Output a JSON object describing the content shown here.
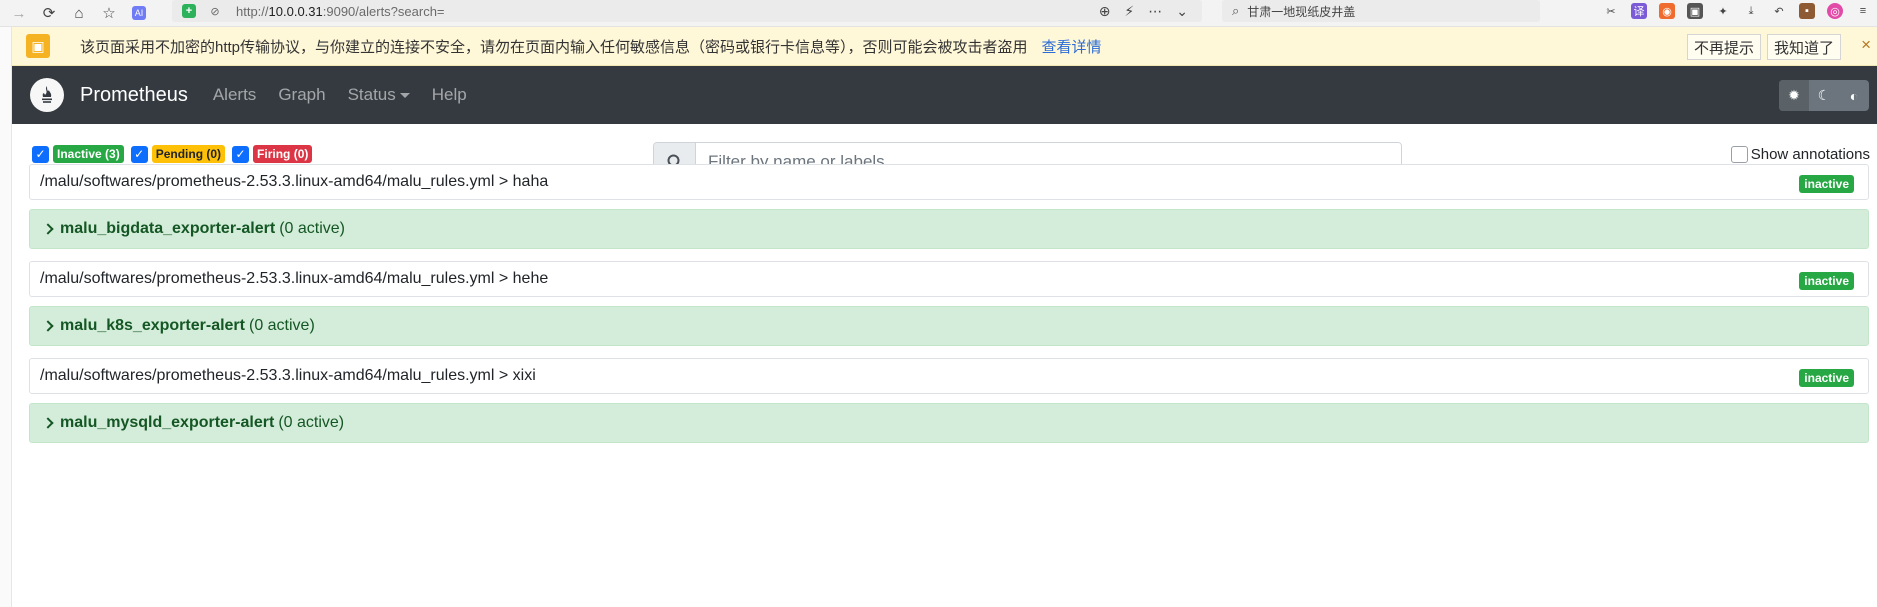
{
  "browser": {
    "url_prefix": "http://",
    "url_host": "10.0.0.31",
    "url_rest": ":9090/alerts?search=",
    "search_text": "甘肃一地现纸皮井盖"
  },
  "warning": {
    "text": "该页面采用不加密的http传输协议，与你建立的连接不安全，请勿在页面内输入任何敏感信息（密码或银行卡信息等），否则可能会被攻击者盗用",
    "link": "查看详情",
    "no_remind": "不再提示",
    "got_it": "我知道了",
    "close": "×"
  },
  "navbar": {
    "brand": "Prometheus",
    "links": [
      "Alerts",
      "Graph",
      "Status",
      "Help"
    ]
  },
  "filters": {
    "inactive": "Inactive (3)",
    "pending": "Pending (0)",
    "firing": "Firing (0)",
    "search_placeholder": "Filter by name or labels",
    "show_annotations": "Show annotations"
  },
  "rule_files": [
    {
      "path": "/malu/softwares/prometheus-2.53.3.linux-amd64/malu_rules.yml > haha",
      "status": "inactive",
      "group": "malu_bigdata_exporter-alert",
      "active": "(0 active)"
    },
    {
      "path": "/malu/softwares/prometheus-2.53.3.linux-amd64/malu_rules.yml > hehe",
      "status": "inactive",
      "group": "malu_k8s_exporter-alert",
      "active": "(0 active)"
    },
    {
      "path": "/malu/softwares/prometheus-2.53.3.linux-amd64/malu_rules.yml > xixi",
      "status": "inactive",
      "group": "malu_mysqld_exporter-alert",
      "active": "(0 active)"
    }
  ]
}
